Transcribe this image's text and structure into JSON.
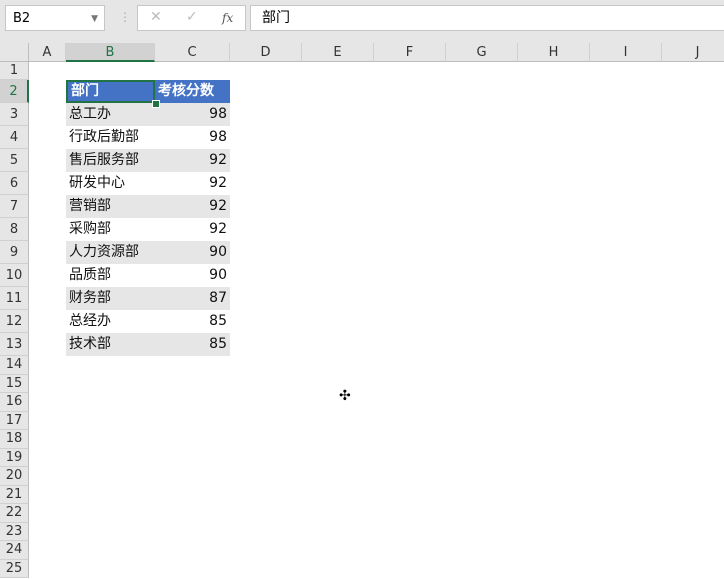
{
  "name_box": "B2",
  "formula_bar": {
    "cancel_icon": "✕",
    "enter_icon": "✓",
    "fx_label": "fx",
    "content": "部门"
  },
  "columns": [
    "A",
    "B",
    "C",
    "D",
    "E",
    "F",
    "G",
    "H",
    "I",
    "J"
  ],
  "rows": [
    "1",
    "2",
    "3",
    "4",
    "5",
    "6",
    "7",
    "8",
    "9",
    "10",
    "11",
    "12",
    "13",
    "14",
    "15",
    "16",
    "17",
    "18",
    "19",
    "20",
    "21",
    "22",
    "23",
    "24",
    "25"
  ],
  "table": {
    "headers": [
      "部门",
      "考核分数"
    ],
    "data": [
      [
        "总工办",
        "98"
      ],
      [
        "行政后勤部",
        "98"
      ],
      [
        "售后服务部",
        "92"
      ],
      [
        "研发中心",
        "92"
      ],
      [
        "营销部",
        "92"
      ],
      [
        "采购部",
        "92"
      ],
      [
        "人力资源部",
        "90"
      ],
      [
        "品质部",
        "90"
      ],
      [
        "财务部",
        "87"
      ],
      [
        "总经办",
        "85"
      ],
      [
        "技术部",
        "85"
      ]
    ]
  },
  "colors": {
    "header_fill": "#4472c4",
    "band_fill": "#e7e6e6",
    "selection": "#217346"
  }
}
